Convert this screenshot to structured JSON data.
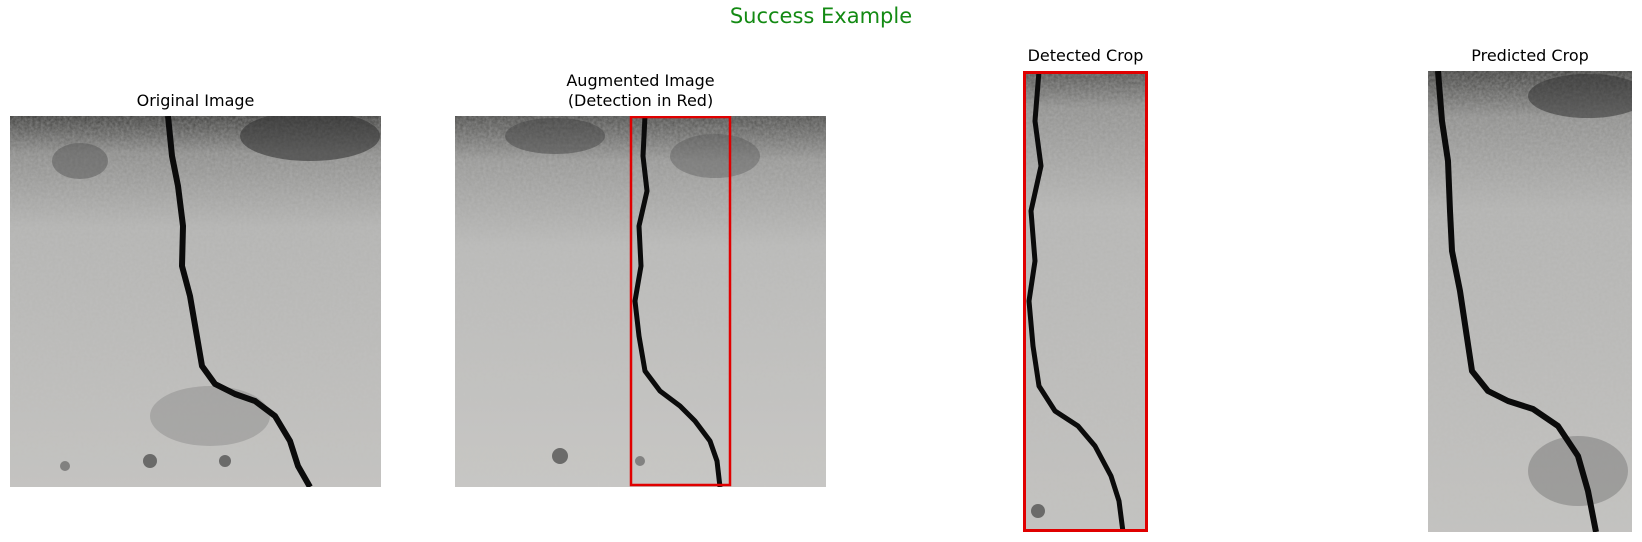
{
  "figure": {
    "suptitle": "Success Example",
    "suptitle_color": "#138a13",
    "panels": [
      {
        "title": "Original Image"
      },
      {
        "title": "Augmented Image\n(Detection in Red)"
      },
      {
        "title": "Detected Crop"
      },
      {
        "title": "Predicted Crop"
      }
    ],
    "detection_box_color": "#e00000",
    "image_subject": "concrete-crack"
  }
}
